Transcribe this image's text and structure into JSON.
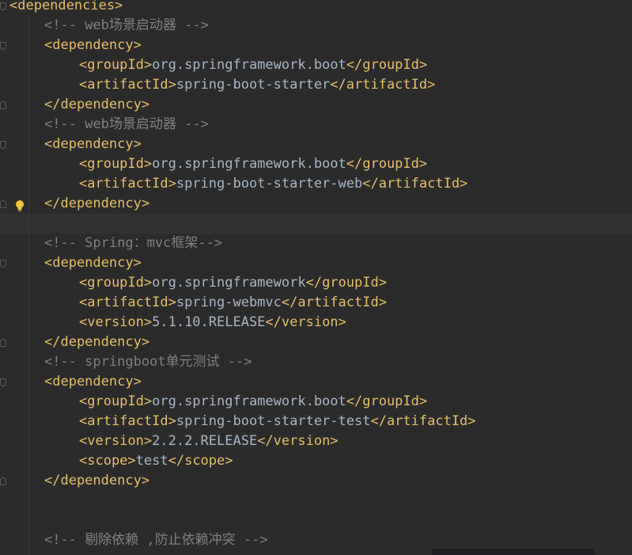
{
  "editor": {
    "lines": [
      {
        "indent": 0,
        "parts": [
          {
            "t": "<dependencies>",
            "c": "tag"
          }
        ]
      },
      {
        "indent": 1,
        "parts": [
          {
            "t": "<!-- web场景启动器 -->",
            "c": "cmt"
          }
        ]
      },
      {
        "indent": 1,
        "parts": [
          {
            "t": "<dependency>",
            "c": "tag"
          }
        ]
      },
      {
        "indent": 2,
        "parts": [
          {
            "t": "<groupId>",
            "c": "tag"
          },
          {
            "t": "org.springframework.boot",
            "c": "txt"
          },
          {
            "t": "</groupId>",
            "c": "tag"
          }
        ]
      },
      {
        "indent": 2,
        "parts": [
          {
            "t": "<artifactId>",
            "c": "tag"
          },
          {
            "t": "spring-boot-starter",
            "c": "txt"
          },
          {
            "t": "</artifactId>",
            "c": "tag"
          }
        ]
      },
      {
        "indent": 1,
        "parts": [
          {
            "t": "</dependency>",
            "c": "tag"
          }
        ]
      },
      {
        "indent": 1,
        "parts": [
          {
            "t": "<!-- web场景启动器 -->",
            "c": "cmt"
          }
        ]
      },
      {
        "indent": 1,
        "parts": [
          {
            "t": "<dependency>",
            "c": "tag"
          }
        ]
      },
      {
        "indent": 2,
        "parts": [
          {
            "t": "<groupId>",
            "c": "tag"
          },
          {
            "t": "org.springframework.boot",
            "c": "txt"
          },
          {
            "t": "</groupId>",
            "c": "tag"
          }
        ]
      },
      {
        "indent": 2,
        "parts": [
          {
            "t": "<artifactId>",
            "c": "tag"
          },
          {
            "t": "spring-boot-starter-web",
            "c": "txt"
          },
          {
            "t": "</artifactId>",
            "c": "tag"
          }
        ]
      },
      {
        "indent": 1,
        "parts": [
          {
            "t": "</dependency>",
            "c": "tag"
          }
        ]
      },
      {
        "indent": 0,
        "parts": [],
        "current": true
      },
      {
        "indent": 1,
        "parts": [
          {
            "t": "<!-- Spring：mvc框架-->",
            "c": "cmt"
          }
        ]
      },
      {
        "indent": 1,
        "parts": [
          {
            "t": "<dependency>",
            "c": "tag"
          }
        ]
      },
      {
        "indent": 2,
        "parts": [
          {
            "t": "<groupId>",
            "c": "tag"
          },
          {
            "t": "org.springframework",
            "c": "txt"
          },
          {
            "t": "</groupId>",
            "c": "tag"
          }
        ]
      },
      {
        "indent": 2,
        "parts": [
          {
            "t": "<artifactId>",
            "c": "tag"
          },
          {
            "t": "spring-webmvc",
            "c": "txt"
          },
          {
            "t": "</artifactId>",
            "c": "tag"
          }
        ]
      },
      {
        "indent": 2,
        "parts": [
          {
            "t": "<version>",
            "c": "tag"
          },
          {
            "t": "5.1.10.RELEASE",
            "c": "txt"
          },
          {
            "t": "</version>",
            "c": "tag"
          }
        ]
      },
      {
        "indent": 1,
        "parts": [
          {
            "t": "</dependency>",
            "c": "tag"
          }
        ]
      },
      {
        "indent": 1,
        "parts": [
          {
            "t": "<!-- springboot单元测试 -->",
            "c": "cmt"
          }
        ]
      },
      {
        "indent": 1,
        "parts": [
          {
            "t": "<dependency>",
            "c": "tag"
          }
        ]
      },
      {
        "indent": 2,
        "parts": [
          {
            "t": "<groupId>",
            "c": "tag"
          },
          {
            "t": "org.springframework.boot",
            "c": "txt"
          },
          {
            "t": "</groupId>",
            "c": "tag"
          }
        ]
      },
      {
        "indent": 2,
        "parts": [
          {
            "t": "<artifactId>",
            "c": "tag"
          },
          {
            "t": "spring-boot-starter-test",
            "c": "txt"
          },
          {
            "t": "</artifactId>",
            "c": "tag"
          }
        ]
      },
      {
        "indent": 2,
        "parts": [
          {
            "t": "<version>",
            "c": "tag"
          },
          {
            "t": "2.2.2.RELEASE",
            "c": "txt"
          },
          {
            "t": "</version>",
            "c": "tag"
          }
        ]
      },
      {
        "indent": 2,
        "parts": [
          {
            "t": "<scope>",
            "c": "tag"
          },
          {
            "t": "test",
            "c": "txt"
          },
          {
            "t": "</scope>",
            "c": "tag"
          }
        ]
      },
      {
        "indent": 1,
        "parts": [
          {
            "t": "</dependency>",
            "c": "tag"
          }
        ]
      },
      {
        "indent": 0,
        "parts": []
      },
      {
        "indent": 0,
        "parts": []
      },
      {
        "indent": 1,
        "parts": [
          {
            "t": "<!-- 剔除依赖 ,防止依赖冲突 -->",
            "c": "cmt"
          }
        ]
      }
    ],
    "colors": {
      "background": "#2b2b2b",
      "tag": "#e8bf6a",
      "text": "#a9b7c6",
      "comment": "#808080"
    },
    "intention_icon": "lightbulb-icon"
  }
}
